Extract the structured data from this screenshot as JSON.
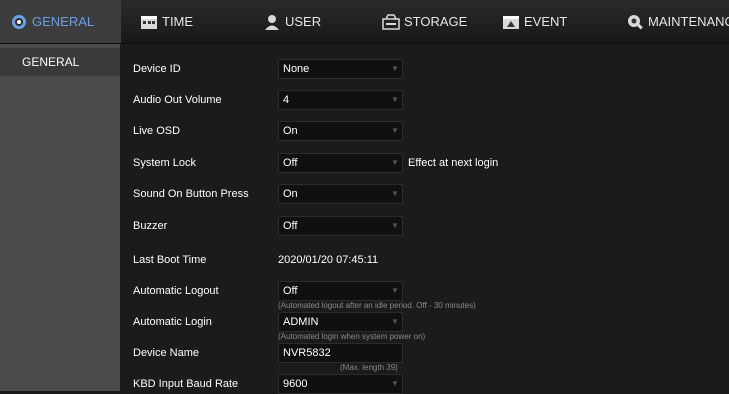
{
  "tabs": [
    {
      "label": "GENERAL",
      "icon": "gear-icon"
    },
    {
      "label": "TIME",
      "icon": "calendar-icon"
    },
    {
      "label": "USER",
      "icon": "user-icon"
    },
    {
      "label": "STORAGE",
      "icon": "storage-icon"
    },
    {
      "label": "EVENT",
      "icon": "event-icon"
    },
    {
      "label": "MAINTENANCE",
      "icon": "maintenance-icon"
    }
  ],
  "sidebar": {
    "items": [
      {
        "label": "GENERAL"
      }
    ]
  },
  "settings": {
    "device_id": {
      "label": "Device ID",
      "value": "None"
    },
    "audio_out_volume": {
      "label": "Audio Out Volume",
      "value": "4"
    },
    "live_osd": {
      "label": "Live OSD",
      "value": "On"
    },
    "system_lock": {
      "label": "System Lock",
      "value": "Off",
      "note": "Effect at next login"
    },
    "sound_on_button_press": {
      "label": "Sound On Button Press",
      "value": "On"
    },
    "buzzer": {
      "label": "Buzzer",
      "value": "Off"
    },
    "last_boot_time": {
      "label": "Last Boot Time",
      "value": "2020/01/20 07:45:11"
    },
    "automatic_logout": {
      "label": "Automatic Logout",
      "value": "Off",
      "hint": "(Automated logout after an idle period. Off - 30 minutes)"
    },
    "automatic_login": {
      "label": "Automatic Login",
      "value": "ADMIN",
      "hint": "(Automated login when system power on)"
    },
    "device_name": {
      "label": "Device Name",
      "value": "NVR5832",
      "hint": "(Max. length 39)"
    },
    "kbd_input_baud_rate": {
      "label": "KBD Input Baud Rate",
      "value": "9600"
    }
  },
  "colors": {
    "active_tab_text": "#6d9fe6",
    "background": "#1b1b1b",
    "sidebar": "#4a4a4a"
  }
}
